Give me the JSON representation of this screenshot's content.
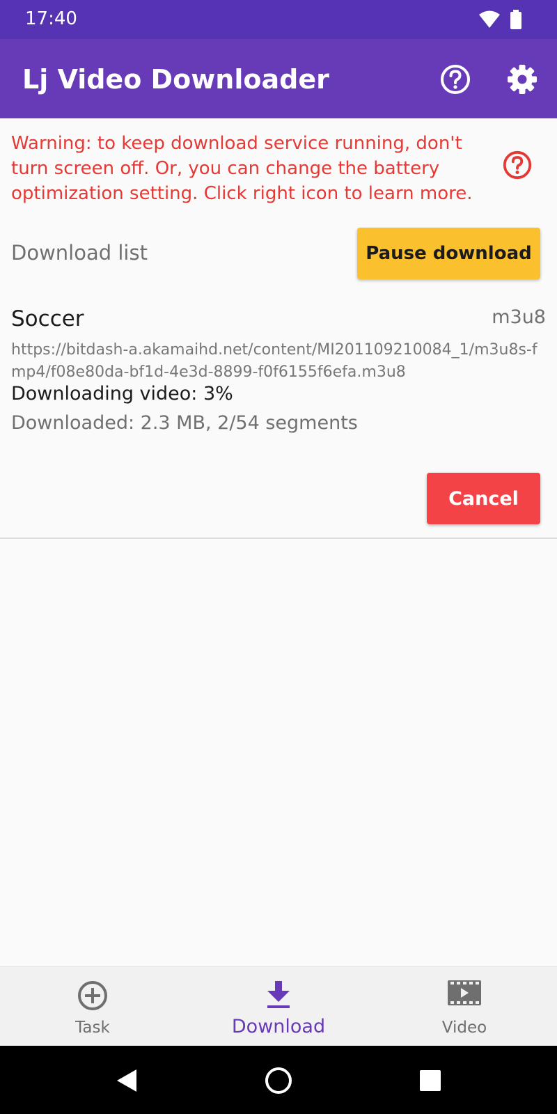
{
  "status_bar": {
    "time": "17:40",
    "icons": [
      "wifi-icon",
      "battery-icon"
    ]
  },
  "app_bar": {
    "title": "Lj Video Downloader",
    "actions": [
      "help-icon",
      "settings-icon"
    ]
  },
  "warning": {
    "text": "Warning: to keep download service running, don't turn screen off. Or, you can change the battery optimization setting. Click right icon to learn more.",
    "color": "#e53935"
  },
  "download_list": {
    "label": "Download list",
    "pause_label": "Pause download",
    "items": [
      {
        "title": "Soccer",
        "format": "m3u8",
        "url": "https://bitdash-a.akamaihd.net/content/MI201109210084_1/m3u8s-fmp4/f08e80da-bf1d-4e3d-8899-f0f6155f6efa.m3u8",
        "status": "Downloading video: 3%",
        "progress": "Downloaded: 2.3 MB, 2/54 segments",
        "cancel_label": "Cancel"
      }
    ]
  },
  "bottom_nav": {
    "items": [
      {
        "label": "Task",
        "icon": "add-circle-icon"
      },
      {
        "label": "Download",
        "icon": "download-icon",
        "active": true
      },
      {
        "label": "Video",
        "icon": "movie-icon"
      }
    ]
  },
  "colors": {
    "primary": "#673ab7",
    "status_bar": "#5533b3",
    "pause": "#fbc02d",
    "cancel": "#f44347"
  }
}
